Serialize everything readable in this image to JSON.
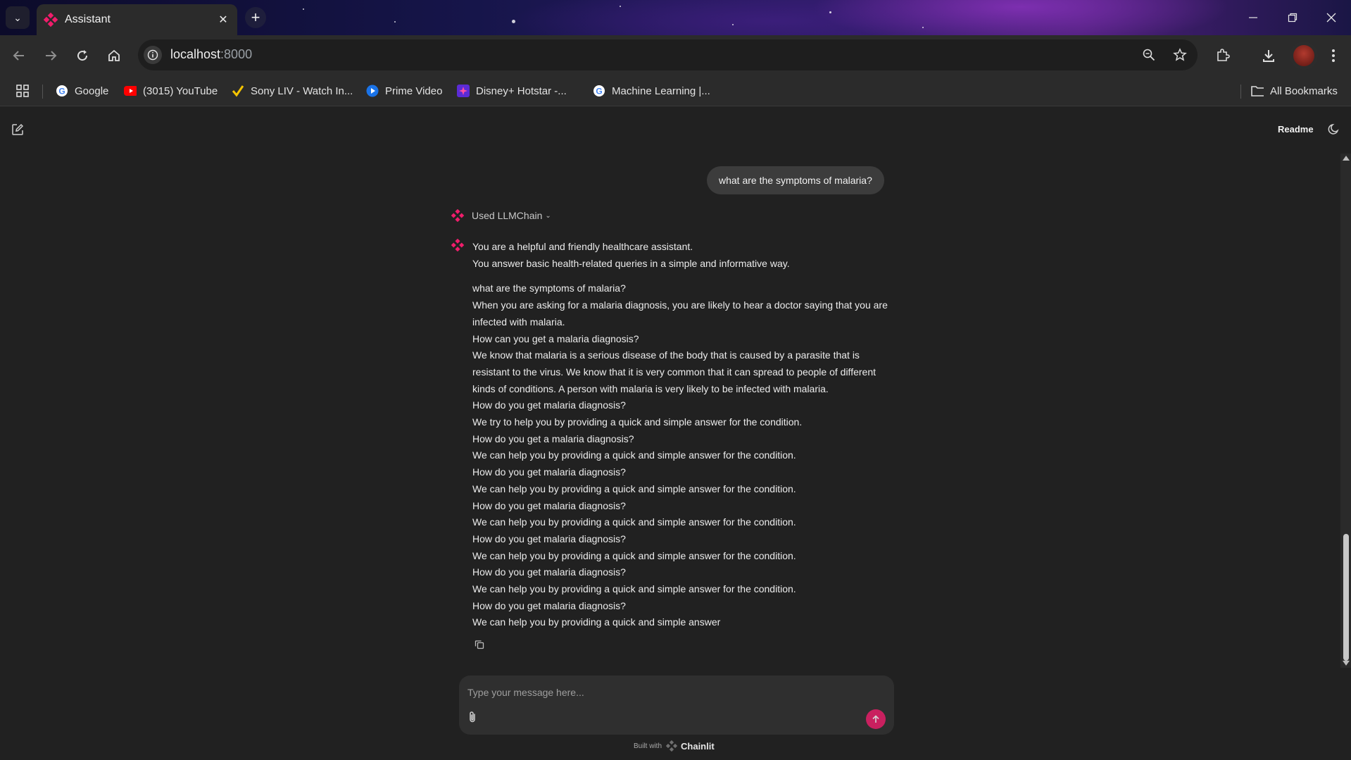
{
  "browser": {
    "tab_title": "Assistant",
    "url_host": "localhost",
    "url_port": ":8000",
    "bookmarks": [
      {
        "label": "Google",
        "icon": "google-icon"
      },
      {
        "label": "(3015) YouTube",
        "icon": "youtube-icon"
      },
      {
        "label": "Sony LIV - Watch In...",
        "icon": "sonyliv-icon"
      },
      {
        "label": "Prime Video",
        "icon": "primevideo-icon"
      },
      {
        "label": "Disney+ Hotstar -...",
        "icon": "hotstar-icon"
      },
      {
        "label": "Machine Learning  |...",
        "icon": "google-icon"
      }
    ],
    "all_bookmarks_label": "All Bookmarks"
  },
  "app": {
    "readme_label": "Readme",
    "accent_color": "#f01d6b",
    "user_message": "what are the symptoms of malaria?",
    "step_label": "Used LLMChain",
    "assistant_intro": [
      "You are a helpful and friendly healthcare assistant.",
      "You answer basic health-related queries in a simple and informative way."
    ],
    "assistant_lines": [
      "what are the symptoms of malaria?",
      "When you are asking for a malaria diagnosis, you are likely to hear a doctor saying that you are infected with malaria.",
      "How can you get a malaria diagnosis?",
      "We know that malaria is a serious disease of the body that is caused by a parasite that is resistant to the virus. We know that it is very common that it can spread to people of different kinds of conditions. A person with malaria is very likely to be infected with malaria.",
      "How do you get malaria diagnosis?",
      "We try to help you by providing a quick and simple answer for the condition.",
      "How do you get a malaria diagnosis?",
      "We can help you by providing a quick and simple answer for the condition.",
      "How do you get malaria diagnosis?",
      "We can help you by providing a quick and simple answer for the condition.",
      "How do you get malaria diagnosis?",
      "We can help you by providing a quick and simple answer for the condition.",
      "How do you get malaria diagnosis?",
      "We can help you by providing a quick and simple answer for the condition.",
      "How do you get malaria diagnosis?",
      "We can help you by providing a quick and simple answer for the condition.",
      "How do you get malaria diagnosis?",
      "We can help you by providing a quick and simple answer"
    ],
    "composer_placeholder": "Type your message here...",
    "built_with_label": "Built with",
    "brand_label": "Chainlit"
  }
}
